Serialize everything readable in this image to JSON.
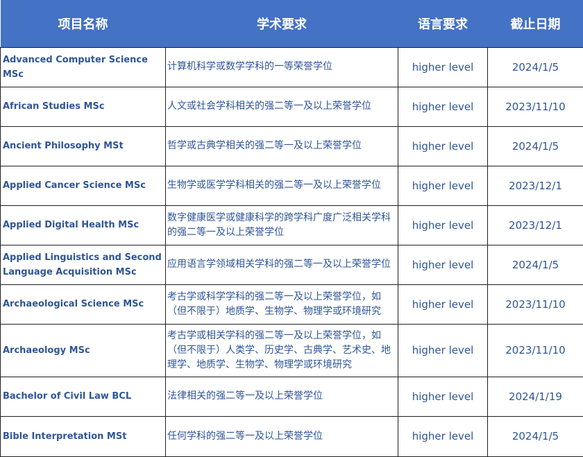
{
  "chart_data": {
    "type": "table",
    "columns": [
      "项目名称",
      "学术要求",
      "语言要求",
      "截止日期"
    ],
    "rows": [
      [
        "Advanced Computer Science MSc",
        "计算机科学或数学学科的一等荣誉学位",
        "higher level",
        "2024/1/5"
      ],
      [
        "African Studies MSc",
        "人文或社会学科相关的强二等一及以上荣誉学位",
        "higher level",
        "2023/11/10"
      ],
      [
        "Ancient Philosophy MSt",
        "哲学或古典学相关的强二等一及以上荣誉学位",
        "higher level",
        "2024/1/5"
      ],
      [
        "Applied Cancer Science MSc",
        "生物学或医学学科相关的强二等一及以上荣誉学位",
        "higher level",
        "2023/12/1"
      ],
      [
        "Applied Digital Health MSc",
        "数字健康医学或健康科学的跨学科广度广泛相关学科的强二等一及以上荣誉学位",
        "higher level",
        "2023/12/1"
      ],
      [
        "Applied Linguistics and Second Language Acquisition MSc",
        "应用语言学领域相关学科的强二等一及以上荣誉学位",
        "higher level",
        "2024/1/5"
      ],
      [
        "Archaeological Science MSc",
        "考古学或科学学科的强二等一及以上荣誉学位，如（但不限于）地质学、生物学、物理学或环境研究",
        "higher level",
        "2023/11/10"
      ],
      [
        "Archaeology MSc",
        "考古学或相关学科的强二等一及以上荣誉学位，如（但不限于）人类学、历史学、古典学、艺术史、地理学、地质学、生物学、物理学或环境研究",
        "higher level",
        "2023/11/10"
      ],
      [
        "Bachelor of Civil Law BCL",
        "法律相关的强二等一及以上荣誉学位",
        "higher level",
        "2024/1/19"
      ],
      [
        "Bible Interpretation MSt",
        "任何学科的强二等一及以上荣誉学位",
        "higher level",
        "2024/1/5"
      ]
    ]
  },
  "colors": {
    "header_bg": "#4472c4",
    "header_text": "#ffffff",
    "cell_text": "#2f5597",
    "border": "#1f1f1f"
  }
}
